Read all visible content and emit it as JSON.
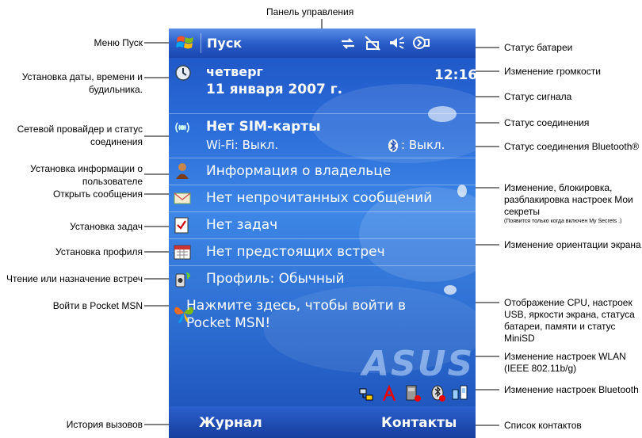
{
  "annotations": {
    "top_label": "Панель управления",
    "left": {
      "start_menu": "Меню Пуск",
      "date_time_1": "Установка даты, времени и",
      "date_time_2": "будильника.",
      "network_1": "Сетевой провайдер и статус",
      "network_2": "соединения",
      "owner_1": "Установка информации о",
      "owner_2": "пользователе",
      "messages": "Открыть сообщения",
      "tasks": "Установка задач",
      "profile": "Установка профиля",
      "appointments": "Чтение или назначение встреч",
      "msn": "Войти в Pocket MSN",
      "call_history": "История вызовов"
    },
    "right": {
      "battery": "Статус батареи",
      "volume": "Изменение громкости",
      "signal": "Статус сигнала",
      "connection": "Статус соединения",
      "bluetooth_status": "Статус соединения Bluetooth®",
      "secrets_1": "Изменение, блокировка,",
      "secrets_2": "разблакировка настроек Мои",
      "secrets_3": "секреты",
      "secrets_note": "(Появится только когда включен My Secrets .)",
      "orientation": "Изменение ориентации экрана",
      "cpu_1": "Отображение CPU, настроек",
      "cpu_2": "USB, яркости экрана, статуса",
      "cpu_3": "батареи, памяти и статус",
      "cpu_4": "MiniSD",
      "wlan_1": "Изменение настроек WLAN",
      "wlan_2": "(IEEE 802.11b/g)",
      "bt_settings": "Изменение настроек Bluetooth",
      "contacts_list": "Список контактов"
    }
  },
  "screen": {
    "start_label": "Пуск",
    "time": "12:16",
    "day": "четверг",
    "date": "11 января 2007 г.",
    "sim": "Нет SIM-карты",
    "wifi": "Wi-Fi: Выкл.",
    "bluetooth": ": Выкл.",
    "owner": "Информация о владельце",
    "messages": "Нет непрочитанных сообщений",
    "tasks": "Нет задач",
    "appointments": "Нет предстоящих встреч",
    "profile": "Профиль: Обычный",
    "msn_1": "Нажмите здесь, чтобы войти в",
    "msn_2": "Pocket MSN!",
    "brand": "ASUS",
    "softkey_left": "Журнал",
    "softkey_right": "Контакты"
  },
  "colors": {
    "screen_blue": "#2a6bd8",
    "bar_blue": "#1b46b0",
    "text_white": "#ffffff"
  }
}
